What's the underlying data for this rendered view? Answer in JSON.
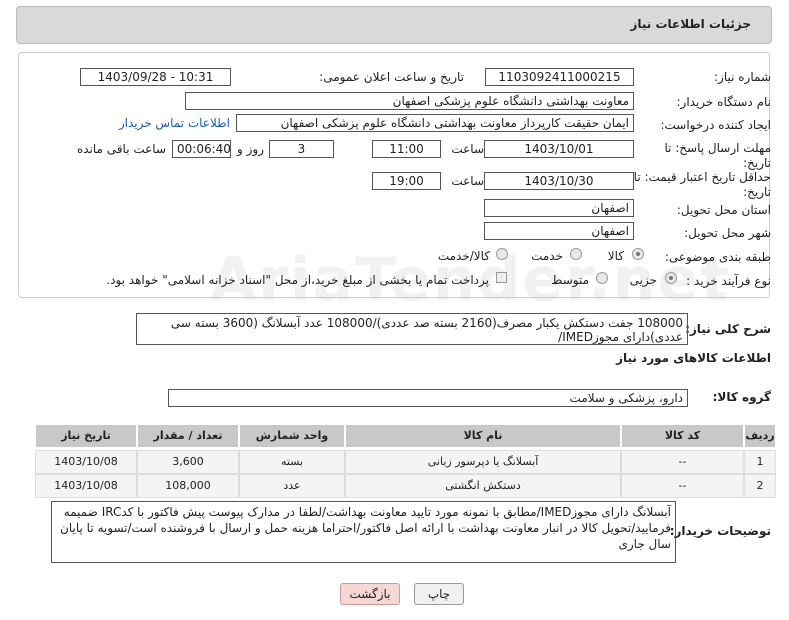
{
  "header": {
    "title": "جزئیات اطلاعات نیاز"
  },
  "form": {
    "need_number_label": "شماره نیاز:",
    "need_number": "1103092411000215",
    "announce_label": "تاریخ و ساعت اعلان عمومی:",
    "announce_value": "1403/09/28 - 10:31",
    "buyer_org_label": "نام دستگاه خریدار:",
    "buyer_org": "معاونت بهداشتی دانشگاه علوم پزشکی اصفهان",
    "creator_label": "ایجاد کننده درخواست:",
    "creator": "ایمان حقیقت کارپرداز معاونت بهداشتی دانشگاه علوم پزشکی اصفهان",
    "contact_link": "اطلاعات تماس خریدار",
    "deadline_label": "مهلت ارسال پاسخ: تا تاریخ:",
    "deadline_date": "1403/10/01",
    "time_label": "ساعت",
    "deadline_time": "11:00",
    "days_value": "3",
    "days_label": "روز و",
    "remaining_time": "00:06:40",
    "remaining_label": "ساعت باقی مانده",
    "validity_label": "حداقل تاریخ اعتبار قیمت: تا تاریخ:",
    "validity_date": "1403/10/30",
    "validity_time": "19:00",
    "province_label": "استان محل تحویل:",
    "province": "اصفهان",
    "city_label": "شهر محل تحویل:",
    "city": "اصفهان",
    "category_label": "طبقه بندی موضوعی:",
    "category_options": [
      "کالا",
      "خدمت",
      "کالا/خدمت"
    ],
    "process_label": "نوع فرآیند خرید :",
    "process_options": [
      "جزیی",
      "متوسط"
    ],
    "payment_note": "پرداخت تمام یا بخشی از مبلغ خرید،از محل \"اسناد خزانه اسلامی\" خواهد بود."
  },
  "description": {
    "label": "شرح کلی نیاز:",
    "text": "108000 جفت دستکش یکبار مصرف(2160 بسته صد عددی)/108000 عدد آبسلانگ (3600 بسته سی عددی)دارای مجوزIMED/"
  },
  "goods": {
    "section_title": "اطلاعات کالاهای مورد نیاز",
    "group_label": "گروه کالا:",
    "group_value": "دارو، پزشکی و سلامت",
    "table": {
      "headers": [
        "ردیف",
        "کد کالا",
        "نام کالا",
        "واحد شمارش",
        "تعداد / مقدار",
        "تاریخ نیاز"
      ],
      "rows": [
        [
          "1",
          "--",
          "آبسلانگ یا دپرسور زبانی",
          "بسته",
          "3,600",
          "1403/10/08"
        ],
        [
          "2",
          "--",
          "دستکش انگشتی",
          "عدد",
          "108,000",
          "1403/10/08"
        ]
      ]
    }
  },
  "buyer_notes": {
    "label": "توضیحات خریدار:",
    "text": "آبسلانگ دارای مجوزIMED/مطابق با نمونه مورد تایید معاونت بهداشت/لطفا در مدارک پیوست پیش فاکتور با کدIRC ضمیمه فرمایید/تحویل کالا در انبار معاونت بهداشت با ارائه اصل فاکتور/احتراما هزینه حمل و ارسال با فروشنده است/تسویه تا پایان سال جاری"
  },
  "buttons": {
    "print": "چاپ",
    "back": "بازگشت"
  },
  "watermark": "AriaTender.net"
}
